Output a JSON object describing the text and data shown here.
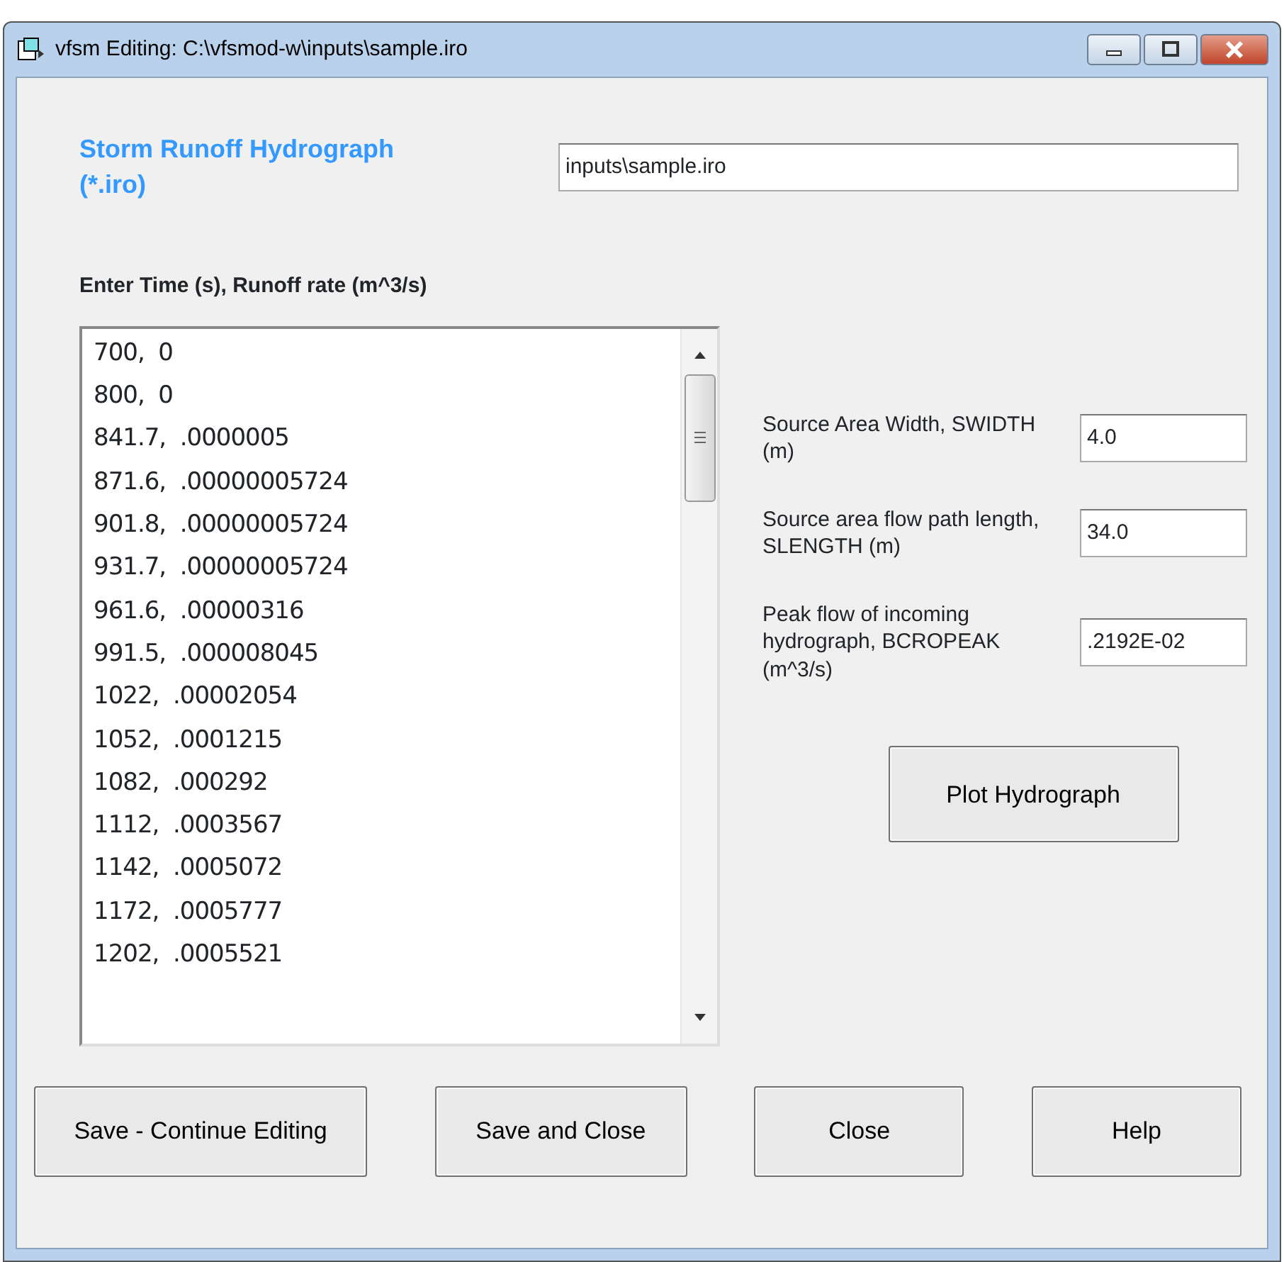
{
  "window": {
    "title": "vfsm Editing: C:\\vfsmod-w\\inputs\\sample.iro"
  },
  "heading": "Storm Runoff Hydrograph (*.iro)",
  "file_field": {
    "value": "inputs\\sample.iro"
  },
  "list_label": "Enter Time (s), Runoff rate (m^3/s)",
  "list_lines": [
    "700,  0",
    "800,  0",
    "841.7,  .0000005",
    "871.6,  .00000005724",
    "901.8,  .00000005724",
    "931.7,  .00000005724",
    "961.6,  .00000316",
    "991.5,  .000008045",
    "1022,  .00002054",
    "1052,  .0001215",
    "1082,  .000292",
    "1112,  .0003567",
    "1142,  .0005072",
    "1172,  .0005777",
    "1202,  .0005521"
  ],
  "params": [
    {
      "label": "Source Area Width, SWIDTH (m)",
      "value": "4.0"
    },
    {
      "label": "Source area flow path length, SLENGTH (m)",
      "value": "34.0"
    },
    {
      "label": "Peak flow of incoming hydrograph, BCROPEAK (m^3/s)",
      "value": ".2192E-02"
    }
  ],
  "plot_button": "Plot Hydrograph",
  "buttons": [
    "Save - Continue Editing",
    "Save and Close",
    "Close",
    "Help"
  ]
}
